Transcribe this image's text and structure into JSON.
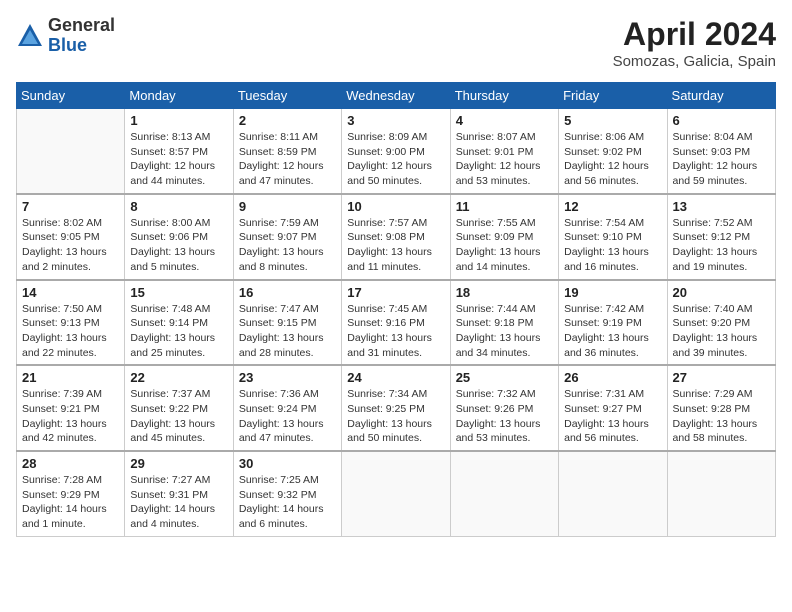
{
  "header": {
    "logo_general": "General",
    "logo_blue": "Blue",
    "title": "April 2024",
    "location": "Somozas, Galicia, Spain"
  },
  "columns": [
    "Sunday",
    "Monday",
    "Tuesday",
    "Wednesday",
    "Thursday",
    "Friday",
    "Saturday"
  ],
  "weeks": [
    [
      {
        "day": "",
        "info": ""
      },
      {
        "day": "1",
        "info": "Sunrise: 8:13 AM\nSunset: 8:57 PM\nDaylight: 12 hours\nand 44 minutes."
      },
      {
        "day": "2",
        "info": "Sunrise: 8:11 AM\nSunset: 8:59 PM\nDaylight: 12 hours\nand 47 minutes."
      },
      {
        "day": "3",
        "info": "Sunrise: 8:09 AM\nSunset: 9:00 PM\nDaylight: 12 hours\nand 50 minutes."
      },
      {
        "day": "4",
        "info": "Sunrise: 8:07 AM\nSunset: 9:01 PM\nDaylight: 12 hours\nand 53 minutes."
      },
      {
        "day": "5",
        "info": "Sunrise: 8:06 AM\nSunset: 9:02 PM\nDaylight: 12 hours\nand 56 minutes."
      },
      {
        "day": "6",
        "info": "Sunrise: 8:04 AM\nSunset: 9:03 PM\nDaylight: 12 hours\nand 59 minutes."
      }
    ],
    [
      {
        "day": "7",
        "info": "Sunrise: 8:02 AM\nSunset: 9:05 PM\nDaylight: 13 hours\nand 2 minutes."
      },
      {
        "day": "8",
        "info": "Sunrise: 8:00 AM\nSunset: 9:06 PM\nDaylight: 13 hours\nand 5 minutes."
      },
      {
        "day": "9",
        "info": "Sunrise: 7:59 AM\nSunset: 9:07 PM\nDaylight: 13 hours\nand 8 minutes."
      },
      {
        "day": "10",
        "info": "Sunrise: 7:57 AM\nSunset: 9:08 PM\nDaylight: 13 hours\nand 11 minutes."
      },
      {
        "day": "11",
        "info": "Sunrise: 7:55 AM\nSunset: 9:09 PM\nDaylight: 13 hours\nand 14 minutes."
      },
      {
        "day": "12",
        "info": "Sunrise: 7:54 AM\nSunset: 9:10 PM\nDaylight: 13 hours\nand 16 minutes."
      },
      {
        "day": "13",
        "info": "Sunrise: 7:52 AM\nSunset: 9:12 PM\nDaylight: 13 hours\nand 19 minutes."
      }
    ],
    [
      {
        "day": "14",
        "info": "Sunrise: 7:50 AM\nSunset: 9:13 PM\nDaylight: 13 hours\nand 22 minutes."
      },
      {
        "day": "15",
        "info": "Sunrise: 7:48 AM\nSunset: 9:14 PM\nDaylight: 13 hours\nand 25 minutes."
      },
      {
        "day": "16",
        "info": "Sunrise: 7:47 AM\nSunset: 9:15 PM\nDaylight: 13 hours\nand 28 minutes."
      },
      {
        "day": "17",
        "info": "Sunrise: 7:45 AM\nSunset: 9:16 PM\nDaylight: 13 hours\nand 31 minutes."
      },
      {
        "day": "18",
        "info": "Sunrise: 7:44 AM\nSunset: 9:18 PM\nDaylight: 13 hours\nand 34 minutes."
      },
      {
        "day": "19",
        "info": "Sunrise: 7:42 AM\nSunset: 9:19 PM\nDaylight: 13 hours\nand 36 minutes."
      },
      {
        "day": "20",
        "info": "Sunrise: 7:40 AM\nSunset: 9:20 PM\nDaylight: 13 hours\nand 39 minutes."
      }
    ],
    [
      {
        "day": "21",
        "info": "Sunrise: 7:39 AM\nSunset: 9:21 PM\nDaylight: 13 hours\nand 42 minutes."
      },
      {
        "day": "22",
        "info": "Sunrise: 7:37 AM\nSunset: 9:22 PM\nDaylight: 13 hours\nand 45 minutes."
      },
      {
        "day": "23",
        "info": "Sunrise: 7:36 AM\nSunset: 9:24 PM\nDaylight: 13 hours\nand 47 minutes."
      },
      {
        "day": "24",
        "info": "Sunrise: 7:34 AM\nSunset: 9:25 PM\nDaylight: 13 hours\nand 50 minutes."
      },
      {
        "day": "25",
        "info": "Sunrise: 7:32 AM\nSunset: 9:26 PM\nDaylight: 13 hours\nand 53 minutes."
      },
      {
        "day": "26",
        "info": "Sunrise: 7:31 AM\nSunset: 9:27 PM\nDaylight: 13 hours\nand 56 minutes."
      },
      {
        "day": "27",
        "info": "Sunrise: 7:29 AM\nSunset: 9:28 PM\nDaylight: 13 hours\nand 58 minutes."
      }
    ],
    [
      {
        "day": "28",
        "info": "Sunrise: 7:28 AM\nSunset: 9:29 PM\nDaylight: 14 hours\nand 1 minute."
      },
      {
        "day": "29",
        "info": "Sunrise: 7:27 AM\nSunset: 9:31 PM\nDaylight: 14 hours\nand 4 minutes."
      },
      {
        "day": "30",
        "info": "Sunrise: 7:25 AM\nSunset: 9:32 PM\nDaylight: 14 hours\nand 6 minutes."
      },
      {
        "day": "",
        "info": ""
      },
      {
        "day": "",
        "info": ""
      },
      {
        "day": "",
        "info": ""
      },
      {
        "day": "",
        "info": ""
      }
    ]
  ]
}
